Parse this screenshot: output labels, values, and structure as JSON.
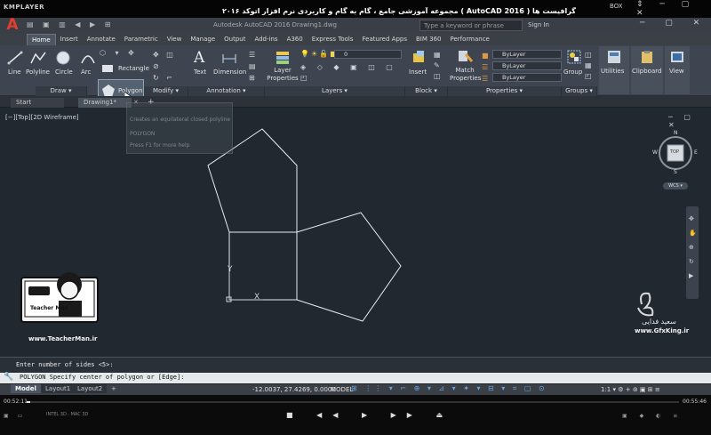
{
  "player": {
    "logo": "KMPLAYER",
    "title": "مجموعه آموزشی جامع ، گام به گام و کاربردی نرم افزار اتوکد ۲۰۱۶ ( AutoCAD 2016 ) مدرس : سعید فدایی (تیچرمن) گروه آموزشی پادشاه گرافیست ها",
    "box_label": "BOX",
    "window_controls": "⇕ ─ ▢ ✕",
    "time_elapsed": "00:52:11",
    "time_total": "00:55:46",
    "transport": "■ ◀◀ ▶ ▶▶ ⏏",
    "left_tools": "▣ ▭",
    "badges": "INTEL 3D · MAC 3D",
    "right_tools": "▣ ◆ ◐ ≡"
  },
  "app": {
    "logo": "A",
    "quick_access": "▤ ▣ ▥ ◀ ▶ ⊞",
    "doc_title": "Autodesk AutoCAD 2016    Drawing1.dwg",
    "search_placeholder": "Type a keyword or phrase",
    "signin": "Sign In",
    "window_controls": "─ ▢ ✕"
  },
  "ribbon_tabs": [
    "Home",
    "Insert",
    "Annotate",
    "Parametric",
    "View",
    "Manage",
    "Output",
    "Add-ins",
    "A360",
    "Express Tools",
    "Featured Apps",
    "BIM 360",
    "Performance"
  ],
  "ribbon": {
    "draw": {
      "line": "Line",
      "polyline": "Polyline",
      "circle": "Circle",
      "arc": "Arc",
      "rectangle": "Rectangle",
      "polygon": "Polygon",
      "panel": "Draw ▾"
    },
    "modify": {
      "panel": "Modify ▾"
    },
    "annotation": {
      "text": "Text",
      "dimension": "Dimension",
      "panel": "Annotation ▾"
    },
    "layers": {
      "layer_properties": "Layer Properties",
      "current_layer": "0",
      "panel": "Layers ▾"
    },
    "block": {
      "insert": "Insert",
      "panel": "Block ▾"
    },
    "properties": {
      "match": "Match Properties",
      "bylayer1": "ByLayer",
      "bylayer2": "ByLayer",
      "bylayer3": "ByLayer",
      "panel": "Properties ▾"
    },
    "groups": {
      "group": "Group",
      "panel": "Groups ▾"
    },
    "utilities": "Utilities",
    "clipboard": "Clipboard",
    "view": "View"
  },
  "doc_tabs": {
    "start": "Start",
    "drawing": "Drawing1*",
    "close": "✕",
    "add": "+"
  },
  "viewport": {
    "label": "[−][Top][2D Wireframe]",
    "controls": "─ ▢ ✕",
    "cube_top": "TOP",
    "cube_n": "N",
    "cube_s": "S",
    "cube_w": "W",
    "cube_e": "E",
    "wcs": "WCS ▾"
  },
  "tooltip": {
    "line1": "Creates an equilateral closed polyline",
    "line2": "POLYGON",
    "line3": "Press F1 for more help"
  },
  "watermarks": {
    "teacher_url": "www.TeacherMan.ir",
    "gfx_url": "www.GfxKing.ir",
    "teacher_brand": "Teacher Man",
    "gfx_name": "سعید فدایی"
  },
  "command": {
    "history": "Enter number of sides <5>:",
    "prompt": "POLYGON Specify center of polygon or [Edge]:",
    "wrench": "🔧"
  },
  "layout_tabs": [
    "Model",
    "Layout1",
    "Layout2",
    "+"
  ],
  "status": {
    "coords": "-12.0037, 27.4269, 0.0000",
    "model": "MODEL",
    "icons": "⊞ ⋮⋮ ▾ ⌐ ⊕ ▾ ⊿ ▾ ✦ ▾ ⊟ ▾ ⌗ ▢ ⊙",
    "scale": "1:1 ▾ ⚙ + ⊚ ▣ ⊞ ≡"
  },
  "colors": {
    "canvas": "#212830",
    "geometry": "#e9edf1",
    "ribbon": "#3e4550",
    "accent": "#e23d2f",
    "ucs": "#cfd3d8"
  }
}
